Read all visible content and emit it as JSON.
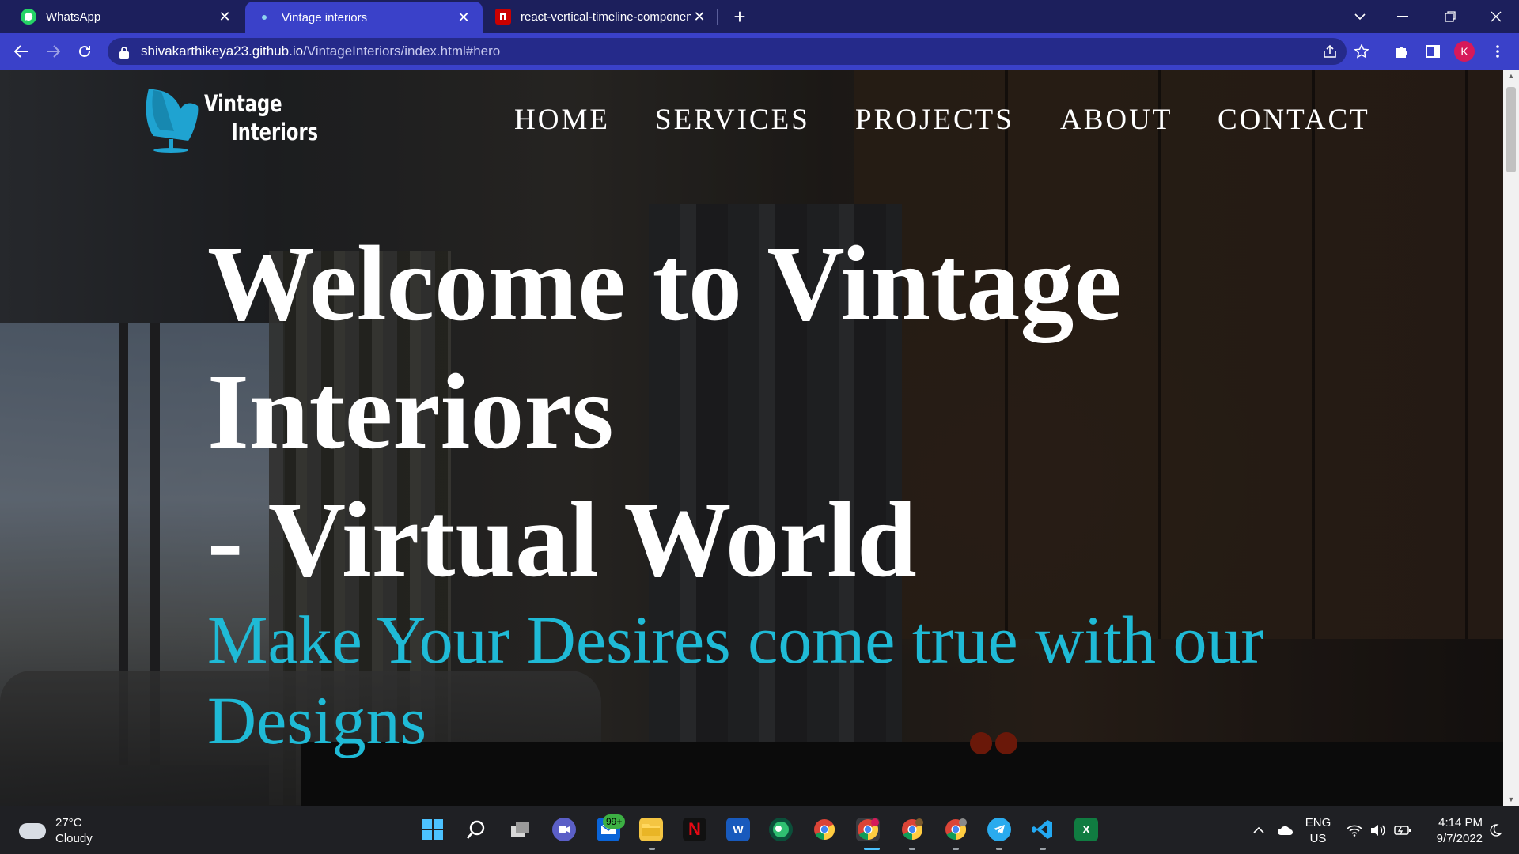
{
  "browser": {
    "tabs": [
      {
        "title": "WhatsApp",
        "icon": "whatsapp-icon",
        "active": false
      },
      {
        "title": "Vintage interiors",
        "icon": "site-favicon",
        "active": true
      },
      {
        "title": "react-vertical-timeline-component",
        "icon": "npm-icon",
        "active": false
      }
    ],
    "new_tab_label": "+",
    "address": {
      "host": "shivakarthikeya23.github.io",
      "path": "/VintageInteriors/index.html#hero"
    },
    "profile_initial": "K",
    "accent_color": "#3a41c9"
  },
  "site": {
    "logo": {
      "line1": "Vintage",
      "line2": "Interiors",
      "icon": "armchair-icon",
      "icon_color": "#1fa3d1"
    },
    "nav": [
      {
        "label": "HOME"
      },
      {
        "label": "SERVICES"
      },
      {
        "label": "PROJECTS"
      },
      {
        "label": "ABOUT"
      },
      {
        "label": "CONTACT"
      }
    ],
    "hero": {
      "title_line1": "Welcome to Vintage",
      "title_line2": "Interiors",
      "title_line3": "- Virtual World",
      "subtitle": "Make Your Desires come true with our Designs",
      "subtitle_color": "#1fbad6"
    }
  },
  "taskbar": {
    "weather": {
      "temp": "27°C",
      "condition": "Cloudy"
    },
    "mail_badge": "99+",
    "language": {
      "line1": "ENG",
      "line2": "US"
    },
    "clock": {
      "time": "4:14 PM",
      "date": "9/7/2022"
    }
  }
}
